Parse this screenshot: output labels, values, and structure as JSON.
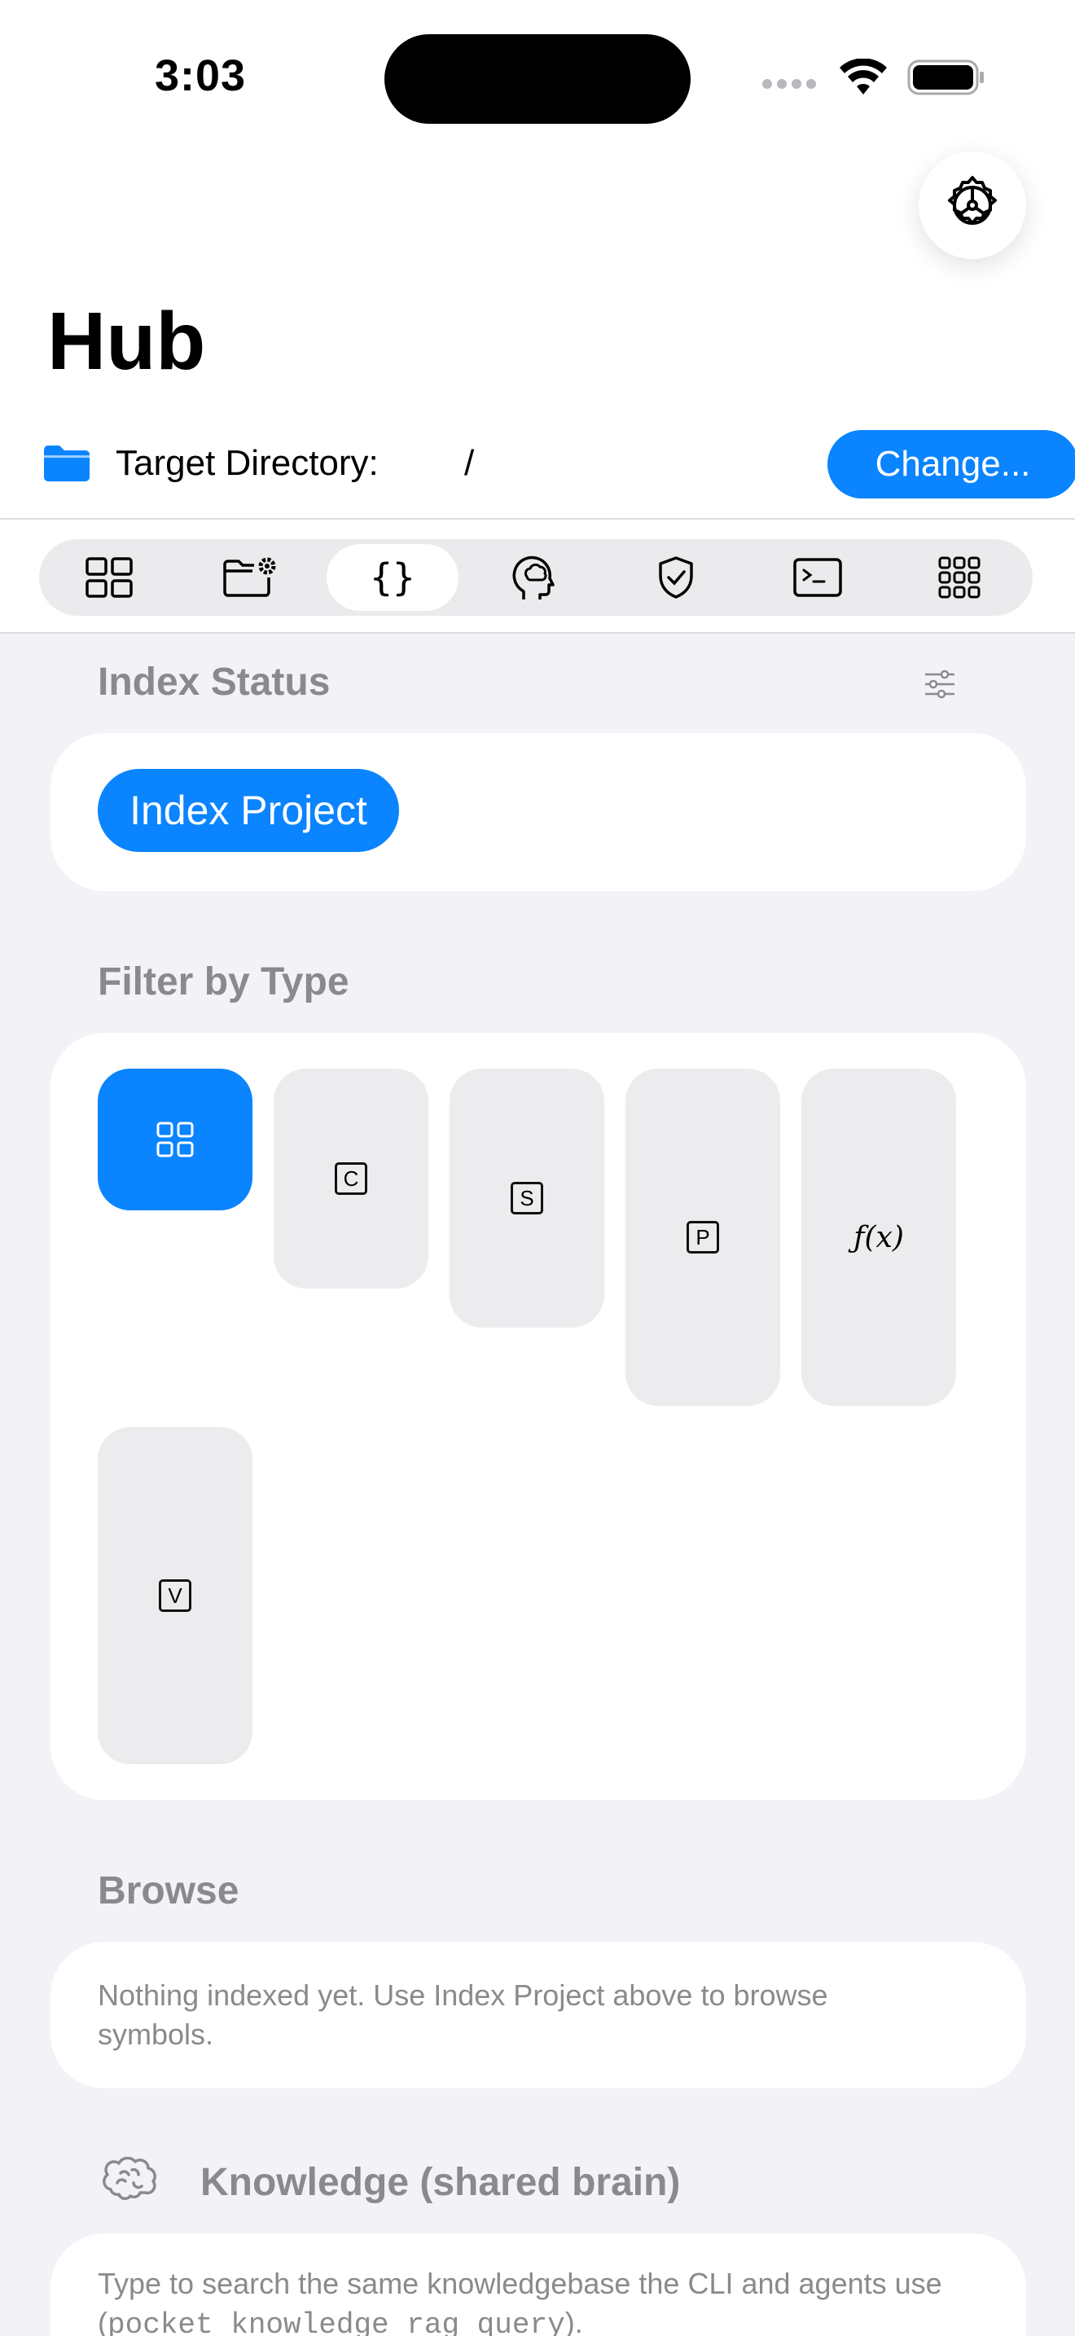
{
  "status_bar": {
    "time": "3:03"
  },
  "header": {
    "title": "Hub",
    "target_label": "Target Directory:",
    "target_value": "/",
    "change_label": "Change..."
  },
  "tabs": [
    {
      "icon": "grid-icon",
      "selected": false
    },
    {
      "icon": "folder-gear-icon",
      "selected": false
    },
    {
      "icon": "braces-icon",
      "label": "{}",
      "selected": true
    },
    {
      "icon": "brain-head-icon",
      "selected": false
    },
    {
      "icon": "shield-check-icon",
      "selected": false
    },
    {
      "icon": "terminal-icon",
      "selected": false
    },
    {
      "icon": "apps-grid-icon",
      "selected": false
    }
  ],
  "index_status": {
    "header": "Index Status",
    "index_button": "Index Project"
  },
  "filter": {
    "header": "Filter by Type",
    "chips": [
      {
        "id": "all",
        "icon": "grid-icon",
        "selected": true
      },
      {
        "id": "class",
        "label": "C",
        "selected": false
      },
      {
        "id": "struct",
        "label": "S",
        "selected": false
      },
      {
        "id": "protocol",
        "label": "P",
        "selected": false
      },
      {
        "id": "function",
        "label": "ƒ(x)",
        "selected": false
      },
      {
        "id": "variable",
        "label": "V",
        "selected": false
      }
    ]
  },
  "browse": {
    "header": "Browse",
    "empty_text": "Nothing indexed yet. Use Index Project above to browse symbols."
  },
  "knowledge": {
    "header": "Knowledge (shared brain)",
    "desc_prefix": "Type to search the same knowledgebase the CLI and agents use (",
    "desc_code": "pocket knowledge rag query",
    "desc_suffix": ")."
  },
  "colors": {
    "accent": "#0a84ff",
    "background": "#f2f2f7",
    "card": "#ffffff",
    "section_header": "#8a8a8e",
    "chip_bg": "#ececee"
  }
}
